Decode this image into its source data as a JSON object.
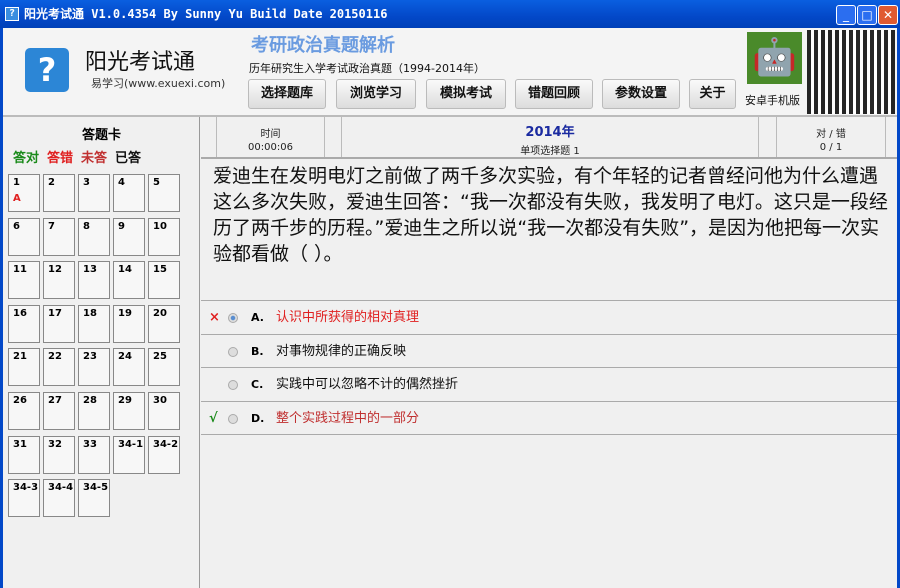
{
  "window": {
    "title": "阳光考试通 V1.0.4354 By Sunny Yu  Build Date 20150116",
    "min": "_",
    "max": "□",
    "close": "✕"
  },
  "header": {
    "app_name": "阳光考试通",
    "app_sub": "易学习(www.exuexi.com)",
    "title": "考研政治真题解析",
    "subtitle": "历年研究生入学考试政治真题（1994-2014年）",
    "buttons": [
      "选择题库",
      "浏览学习",
      "模拟考试",
      "错题回顾",
      "参数设置",
      "关于"
    ],
    "android_label": "安卓手机版"
  },
  "card": {
    "title": "答题卡",
    "legend": {
      "correct": "答对",
      "wrong": "答错",
      "unanswered": "未答",
      "answered": "已答"
    },
    "cells": [
      {
        "n": "1",
        "a": "A"
      },
      {
        "n": "2"
      },
      {
        "n": "3"
      },
      {
        "n": "4"
      },
      {
        "n": "5"
      },
      {
        "n": "6"
      },
      {
        "n": "7"
      },
      {
        "n": "8"
      },
      {
        "n": "9"
      },
      {
        "n": "10"
      },
      {
        "n": "11"
      },
      {
        "n": "12"
      },
      {
        "n": "13"
      },
      {
        "n": "14"
      },
      {
        "n": "15"
      },
      {
        "n": "16"
      },
      {
        "n": "17"
      },
      {
        "n": "18"
      },
      {
        "n": "19"
      },
      {
        "n": "20"
      },
      {
        "n": "21"
      },
      {
        "n": "22"
      },
      {
        "n": "23"
      },
      {
        "n": "24"
      },
      {
        "n": "25"
      },
      {
        "n": "26"
      },
      {
        "n": "27"
      },
      {
        "n": "28"
      },
      {
        "n": "29"
      },
      {
        "n": "30"
      },
      {
        "n": "31"
      },
      {
        "n": "32"
      },
      {
        "n": "33"
      },
      {
        "n": "34-1"
      },
      {
        "n": "34-2"
      },
      {
        "n": "34-3"
      },
      {
        "n": "34-4"
      },
      {
        "n": "34-5"
      }
    ]
  },
  "status": {
    "time_label": "时间",
    "time": "00:00:06",
    "year": "2014年",
    "qtype": "单项选择题 1",
    "score_label": "对 / 错",
    "score": "0 / 1"
  },
  "question": "爱迪生在发明电灯之前做了两千多次实验，有个年轻的记者曾经问他为什么遭遇这么多次失败，爱迪生回答：“我一次都没有失败，我发明了电灯。这只是一段经历了两千步的历程。”爱迪生之所以说“我一次都没有失败”，是因为他把每一次实验都看做（ ）。",
  "options": [
    {
      "letter": "A.",
      "text": "认识中所获得的相对真理",
      "mark": "×",
      "state": "wrong"
    },
    {
      "letter": "B.",
      "text": "对事物规律的正确反映",
      "mark": "",
      "state": ""
    },
    {
      "letter": "C.",
      "text": "实践中可以忽略不计的偶然挫折",
      "mark": "",
      "state": ""
    },
    {
      "letter": "D.",
      "text": "整个实践过程中的一部分",
      "mark": "√",
      "state": "correct"
    }
  ],
  "colors": {
    "correct": "#1a8a1a",
    "wrong": "#e02020",
    "unanswered": "#c03030"
  }
}
